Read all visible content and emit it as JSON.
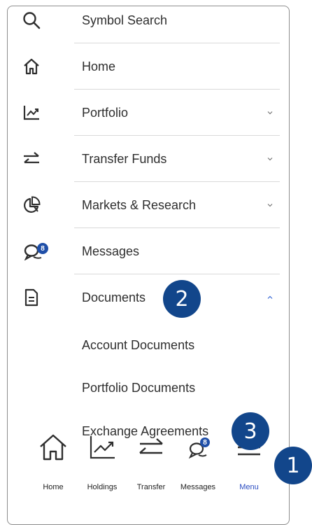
{
  "menu": {
    "items": [
      {
        "label": "Symbol Search",
        "icon": "search-icon"
      },
      {
        "label": "Home",
        "icon": "home-icon"
      },
      {
        "label": "Portfolio",
        "icon": "chart-line-icon",
        "expandable": true
      },
      {
        "label": "Transfer Funds",
        "icon": "transfer-arrows-icon",
        "expandable": true
      },
      {
        "label": "Markets & Research",
        "icon": "pie-chart-icon",
        "expandable": true
      },
      {
        "label": "Messages",
        "icon": "messages-icon",
        "badge": "8"
      },
      {
        "label": "Documents",
        "icon": "document-icon",
        "expanded": true
      }
    ],
    "documents_subitems": [
      "Account Documents",
      "Portfolio Documents",
      "Exchange Agreements"
    ]
  },
  "callouts": [
    "1",
    "2",
    "3"
  ],
  "tabbar": {
    "tabs": [
      {
        "label": "Home",
        "icon": "home-icon"
      },
      {
        "label": "Holdings",
        "icon": "chart-line-icon"
      },
      {
        "label": "Transfer",
        "icon": "transfer-arrows-icon"
      },
      {
        "label": "Messages",
        "icon": "messages-icon",
        "badge": "8"
      },
      {
        "label": "Menu",
        "icon": "hamburger-icon",
        "active": true
      }
    ]
  },
  "colors": {
    "callout": "#12468b",
    "active_tab": "#2a4cc1",
    "badge": "#1f4fa8",
    "divider": "#d9d9d9"
  }
}
